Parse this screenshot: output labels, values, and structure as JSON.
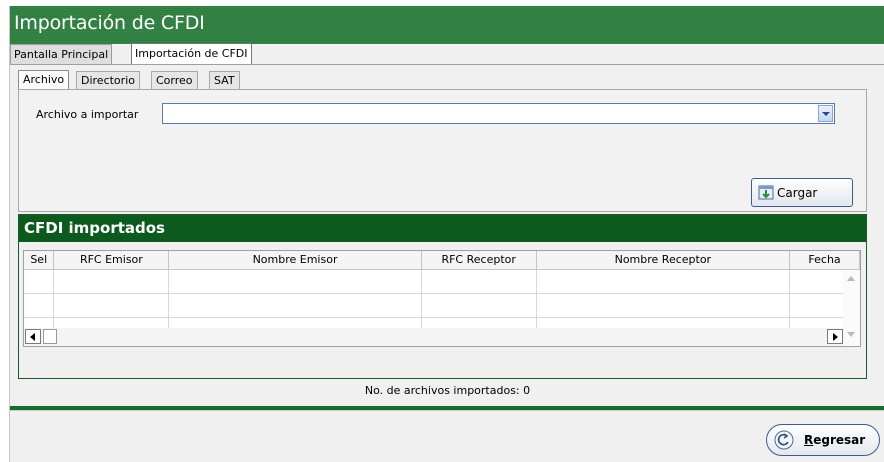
{
  "window": {
    "title": "Importación de CFDI"
  },
  "main_tabs": [
    {
      "label": "Pantalla Principal"
    },
    {
      "label": "Importación de CFDI"
    }
  ],
  "sub_tabs": [
    {
      "label": "Archivo"
    },
    {
      "label": "Directorio"
    },
    {
      "label": "Correo"
    },
    {
      "label": "SAT"
    }
  ],
  "file_import": {
    "label": "Archivo a importar",
    "value": "",
    "load_button": "Cargar"
  },
  "imported": {
    "title": "CFDI importados",
    "columns": [
      "Sel",
      "RFC Emisor",
      "Nombre Emisor",
      "RFC Receptor",
      "Nombre Receptor",
      "Fecha"
    ],
    "rows": []
  },
  "status": {
    "count_text": "No. de archivos importados: 0"
  },
  "back_button": {
    "label": "Regresar"
  },
  "colors": {
    "title_bar": "#2d7d3e",
    "header_green": "#0d5a1e",
    "accent_blue": "#3c5d8c"
  }
}
